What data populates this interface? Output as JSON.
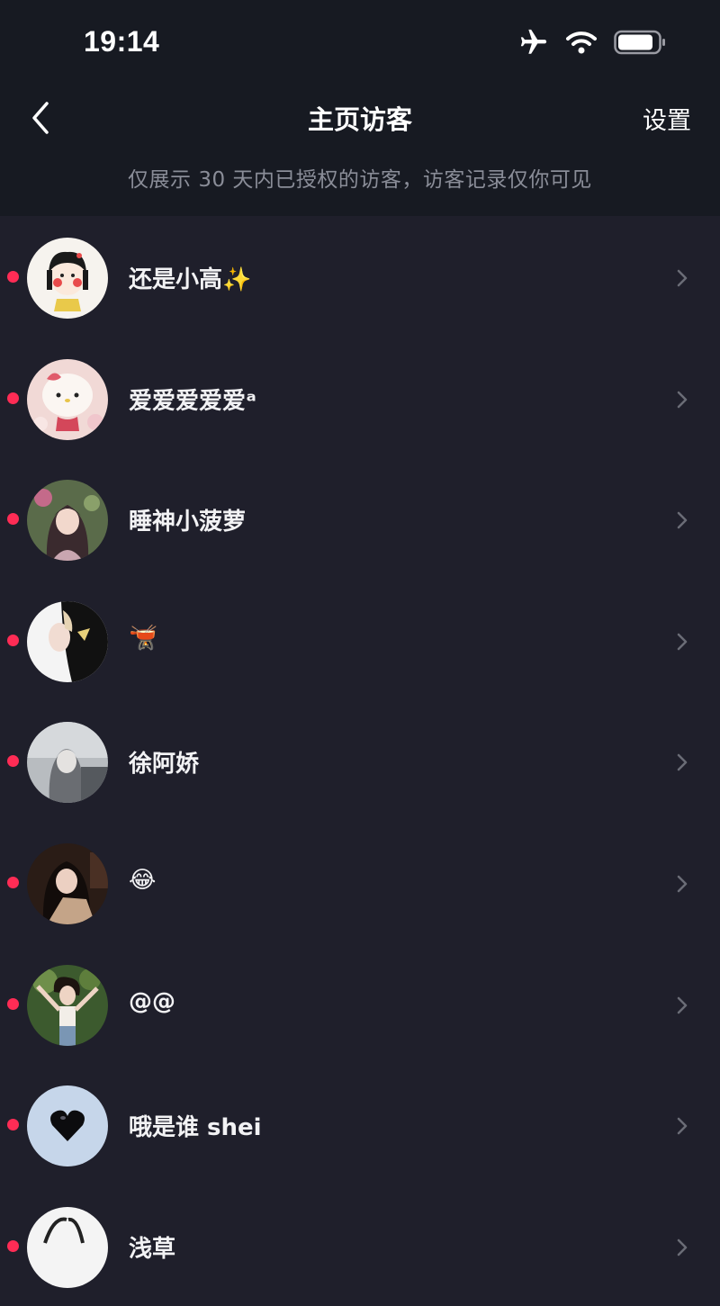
{
  "status_bar": {
    "time": "19:14",
    "icons": [
      "airplane-icon",
      "wifi-icon",
      "battery-icon"
    ]
  },
  "nav": {
    "back_icon": "chevron-left-icon",
    "title": "主页访客",
    "settings_label": "设置"
  },
  "subtitle": "仅展示 30 天内已授权的访客，访客记录仅你可见",
  "visitors": [
    {
      "name": "还是小高✨",
      "unread": true
    },
    {
      "name": "爱爱爱爱爱ᵃ",
      "unread": true
    },
    {
      "name": "睡神小菠萝",
      "unread": true
    },
    {
      "name": "🫕",
      "unread": true
    },
    {
      "name": "徐阿娇",
      "unread": true
    },
    {
      "name": "😂",
      "unread": true
    },
    {
      "name": "@@",
      "unread": true
    },
    {
      "name": "哦是谁 shei",
      "unread": true
    },
    {
      "name": "浅草",
      "unread": true
    }
  ],
  "colors": {
    "background": "#1f1f2b",
    "header_background": "#171a22",
    "unread_dot": "#fe2c55",
    "subtitle_text": "#8a8d98"
  }
}
